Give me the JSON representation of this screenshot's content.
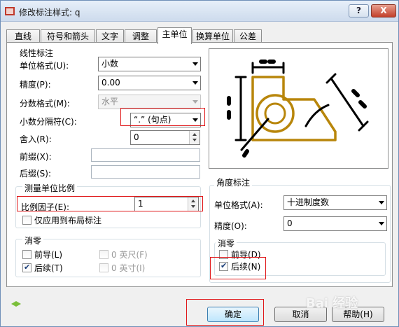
{
  "window": {
    "title": "修改标注样式: q"
  },
  "titlebar": {
    "help": "?",
    "close": "X"
  },
  "tabs": [
    "直线",
    "符号和箭头",
    "文字",
    "调整",
    "主单位",
    "换算单位",
    "公差"
  ],
  "linear": {
    "section_title": "线性标注",
    "unit_format_label": "单位格式(U):",
    "unit_format_value": "小数",
    "precision_label": "精度(P):",
    "precision_value": "0.00",
    "fraction_format_label": "分数格式(M):",
    "fraction_format_value": "水平",
    "decimal_separator_label": "小数分隔符(C):",
    "decimal_separator_value": "“.” (句点)",
    "round_off_label": "舍入(R):",
    "round_off_value": "0",
    "prefix_label": "前缀(X):",
    "suffix_label": "后缀(S):"
  },
  "scale": {
    "group_title": "测量单位比例",
    "factor_label": "比例因子(E):",
    "factor_value": "1",
    "layout_only_label": "仅应用到布局标注"
  },
  "zero_linear": {
    "group_title": "消零",
    "leading_label": "前导(L)",
    "trailing_label": "后续(T)",
    "feet_label": "0 英尺(F)",
    "inches_label": "0 英寸(I)"
  },
  "angular": {
    "group_title": "角度标注",
    "unit_format_label": "单位格式(A):",
    "unit_format_value": "十进制度数",
    "precision_label": "精度(O):",
    "precision_value": "0",
    "zero_title": "消零",
    "leading_label": "前导(D)",
    "trailing_label": "后续(N)"
  },
  "buttons": {
    "ok": "确定",
    "cancel": "取消",
    "help": "帮助(H)"
  },
  "watermark": "Bai 经验",
  "colors": {
    "preview_shape": "#b8860b",
    "highlight": "#e0191b"
  }
}
